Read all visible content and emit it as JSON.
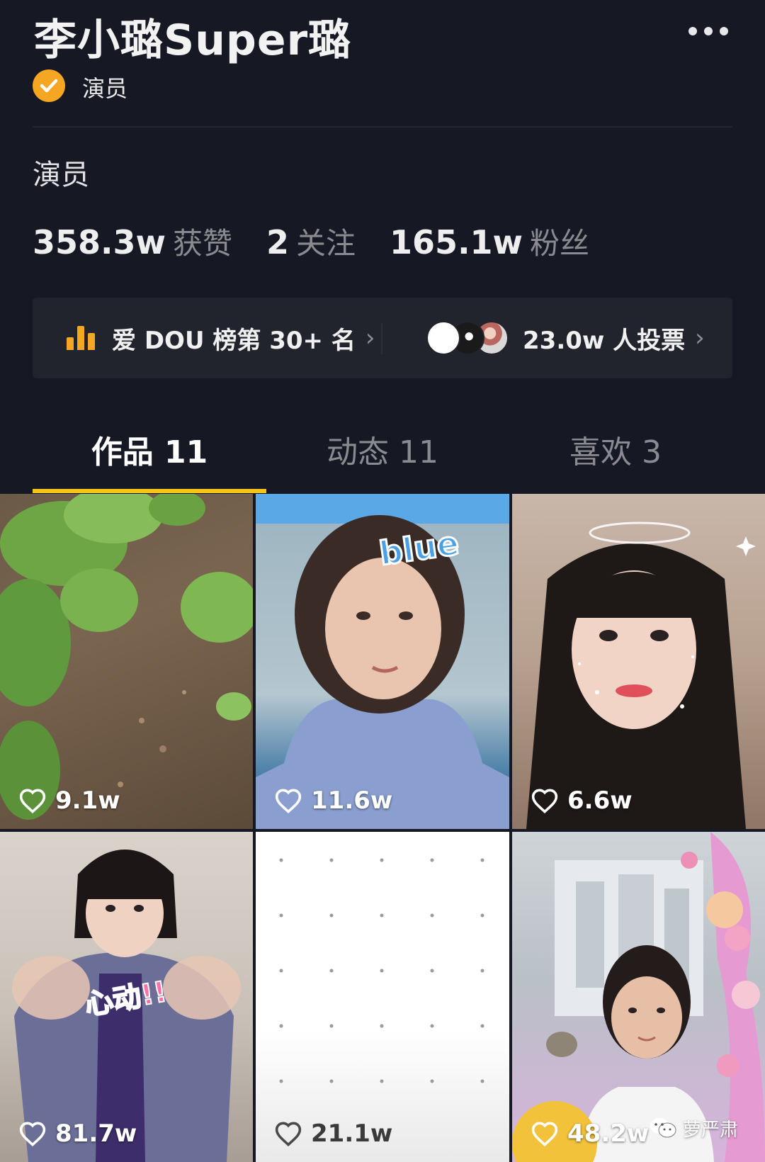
{
  "profile": {
    "name": "李小璐Super璐",
    "verified_label": "演员",
    "bio": "演员"
  },
  "stats": [
    {
      "value": "358.3w",
      "label": "获赞"
    },
    {
      "value": "2",
      "label": "关注"
    },
    {
      "value": "165.1w",
      "label": "粉丝"
    }
  ],
  "ranking": {
    "rank_text": "爱 DOU 榜第 30+ 名",
    "votes_text": "23.0w 人投票"
  },
  "tabs": [
    {
      "label": "作品 11",
      "active": true
    },
    {
      "label": "动态 11",
      "active": false
    },
    {
      "label": "喜欢 3",
      "active": false
    }
  ],
  "videos": [
    {
      "likes": "9.1w",
      "thumb": "green-leaves-soil"
    },
    {
      "likes": "11.6w",
      "thumb": "woman-blue-sticker",
      "sticker": "blue"
    },
    {
      "likes": "6.6w",
      "thumb": "woman-filter-sparkles"
    },
    {
      "likes": "81.7w",
      "thumb": "woman-jacket",
      "sticker": "心动!!"
    },
    {
      "likes": "21.1w",
      "thumb": "white-dotted"
    },
    {
      "likes": "48.2w",
      "thumb": "girl-flowers"
    }
  ],
  "watermark": {
    "text": "萝严肃",
    "icon": "wechat-icon"
  },
  "colors": {
    "background": "#161823",
    "card": "#22242d",
    "accent_orange": "#f5a623",
    "tab_underline": "#f5c518",
    "muted_text": "#8a8b91"
  },
  "icons": {
    "more": "more-dots-icon",
    "verified": "verified-check-icon",
    "rank": "bar-chart-icon",
    "chevron": "chevron-right-icon",
    "like": "heart-outline-icon"
  }
}
